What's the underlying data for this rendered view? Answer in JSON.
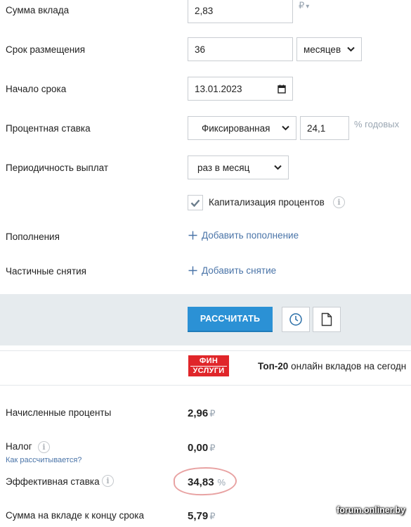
{
  "form": {
    "deposit_label": "Сумма вклада",
    "deposit_value": "2,83",
    "deposit_currency": "₽",
    "deposit_currency_chevron": "▾",
    "term_label": "Срок размещения",
    "term_value": "36",
    "term_unit": "месяцев",
    "start_label": "Начало срока",
    "start_value": "13.01.2023",
    "rate_label": "Процентная ставка",
    "rate_type": "Фиксированная",
    "rate_value": "24,1",
    "rate_unit": "% годовых",
    "payout_label": "Периодичность выплат",
    "payout_value": "раз в месяц",
    "capitalization_label": "Капитализация процентов",
    "capitalization_checked": true,
    "topups_label": "Пополнения",
    "topups_link": "Добавить пополнение",
    "withdrawals_label": "Частичные снятия",
    "withdrawals_link": "Добавить снятие"
  },
  "actions": {
    "calculate_label": "РАССЧИТАТЬ",
    "icons": [
      "clock-icon",
      "document-icon"
    ]
  },
  "banner": {
    "logo_line1": "ФИН",
    "logo_line2": "УСЛУГИ",
    "bold_text": "Топ-20",
    "text": " онлайн вкладов на сегодн"
  },
  "results": {
    "interest_label": "Начисленные проценты",
    "interest_value": "2,96",
    "tax_label": "Налог",
    "tax_value": "0,00",
    "tax_link": "Как рассчитывается?",
    "effective_label": "Эффективная ставка",
    "effective_value": "34,83",
    "effective_unit": "%",
    "total_label": "Сумма на вкладе к концу срока",
    "total_value": "5,79",
    "currency": "₽"
  },
  "info_glyph": "i",
  "watermark": "forum.onliner.by",
  "colors": {
    "primary": "#2b91d5",
    "link": "#4a74a8",
    "band": "#e6ebee",
    "logo_red": "#e0262a",
    "highlight": "#e8a2a2"
  }
}
